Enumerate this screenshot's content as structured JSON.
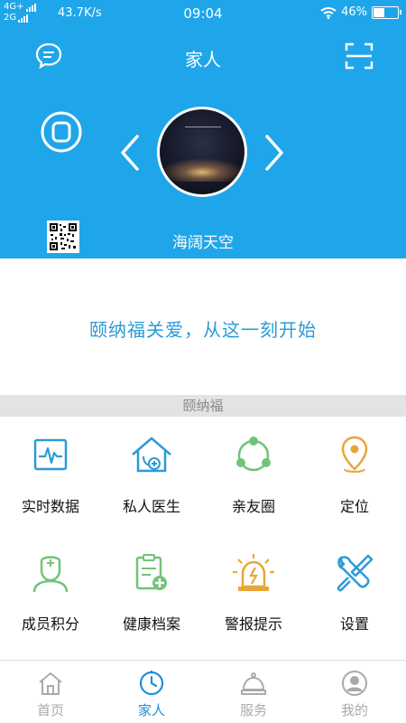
{
  "status_bar": {
    "network_top": "4G+",
    "network_bottom": "2G",
    "speed": "43.7K/s",
    "time": "09:04",
    "battery": "46%",
    "battery_level": 0.46
  },
  "header": {
    "title": "家人",
    "member_name": "海阔天空",
    "background": "#1fa6ea"
  },
  "slogan": "颐纳福关爱，从这一刻开始",
  "section_title": "颐纳福",
  "features": [
    {
      "label": "实时数据",
      "icon": "heartbeat-monitor-icon",
      "color": "#2a9bd6"
    },
    {
      "label": "私人医生",
      "icon": "doctor-house-icon",
      "color": "#2a9bd6"
    },
    {
      "label": "亲友圈",
      "icon": "friends-circle-icon",
      "color": "#72c37a"
    },
    {
      "label": "定位",
      "icon": "location-pin-icon",
      "color": "#e9a53a"
    },
    {
      "label": "成员积分",
      "icon": "member-nurse-icon",
      "color": "#72c37a"
    },
    {
      "label": "健康档案",
      "icon": "health-record-icon",
      "color": "#72c37a"
    },
    {
      "label": "警报提示",
      "icon": "alarm-light-icon",
      "color": "#e9a53a"
    },
    {
      "label": "设置",
      "icon": "settings-tools-icon",
      "color": "#2a9bd6"
    }
  ],
  "bottom_nav": [
    {
      "label": "首页",
      "icon": "home-icon",
      "active": false
    },
    {
      "label": "家人",
      "icon": "clock-family-icon",
      "active": true
    },
    {
      "label": "服务",
      "icon": "service-bell-icon",
      "active": false
    },
    {
      "label": "我的",
      "icon": "profile-icon",
      "active": false
    }
  ],
  "colors": {
    "accent": "#1fa6ea",
    "active_nav": "#1f8fd6",
    "inactive_nav": "#aaaaaa"
  }
}
